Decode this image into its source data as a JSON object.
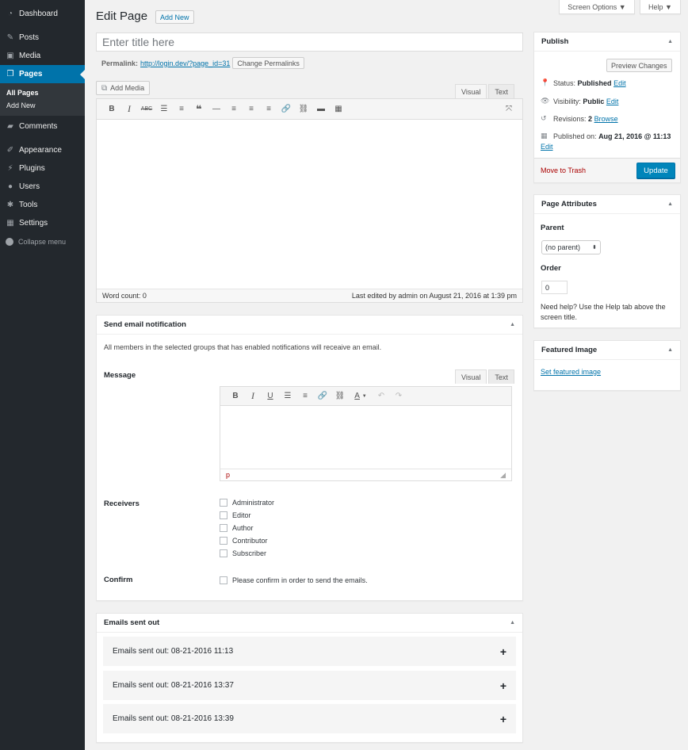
{
  "sidebar": {
    "items": [
      {
        "label": "Dashboard",
        "icon": "dashboard-icon"
      },
      {
        "label": "Posts",
        "icon": "pin-icon"
      },
      {
        "label": "Media",
        "icon": "media-icon"
      },
      {
        "label": "Pages",
        "icon": "pages-icon"
      },
      {
        "label": "Comments",
        "icon": "comments-icon"
      },
      {
        "label": "Appearance",
        "icon": "brush-icon"
      },
      {
        "label": "Plugins",
        "icon": "plugin-icon"
      },
      {
        "label": "Users",
        "icon": "users-icon"
      },
      {
        "label": "Tools",
        "icon": "wrench-icon"
      },
      {
        "label": "Settings",
        "icon": "settings-icon"
      }
    ],
    "submenu": [
      "All Pages",
      "Add New"
    ],
    "collapse": "Collapse menu"
  },
  "top": {
    "screen_options": "Screen Options ▼",
    "help": "Help ▼"
  },
  "header": {
    "title": "Edit Page",
    "add_new": "Add New"
  },
  "post": {
    "title_placeholder": "Enter title here",
    "permalink_label": "Permalink:",
    "permalink_url": "http://login.dev/?page_id=31",
    "change_permalinks": "Change Permalinks",
    "add_media": "Add Media",
    "tab_visual": "Visual",
    "tab_text": "Text",
    "word_count": "Word count: 0",
    "last_edited": "Last edited by admin on August 21, 2016 at 1:39 pm"
  },
  "notify": {
    "title": "Send email notification",
    "intro": "All members in the selected groups that has enabled notifications will receaive an email.",
    "message_label": "Message",
    "tab_visual": "Visual",
    "tab_text": "Text",
    "path": "p",
    "receivers_label": "Receivers",
    "receivers": [
      "Administrator",
      "Editor",
      "Author",
      "Contributor",
      "Subscriber"
    ],
    "confirm_label": "Confirm",
    "confirm_text": "Please confirm in order to send the emails."
  },
  "sent": {
    "title": "Emails sent out",
    "rows": [
      "Emails sent out: 08-21-2016 11:13",
      "Emails sent out: 08-21-2016 13:37",
      "Emails sent out: 08-21-2016 13:39"
    ]
  },
  "publish": {
    "title": "Publish",
    "preview": "Preview Changes",
    "status_label": "Status:",
    "status_value": "Published",
    "visibility_label": "Visibility:",
    "visibility_value": "Public",
    "revisions_label": "Revisions:",
    "revisions_value": "2",
    "browse": "Browse",
    "published_label": "Published on:",
    "published_value": "Aug 21, 2016 @ 11:13",
    "edit": "Edit",
    "trash": "Move to Trash",
    "update": "Update"
  },
  "attributes": {
    "title": "Page Attributes",
    "parent_label": "Parent",
    "parent_value": "(no parent)",
    "order_label": "Order",
    "order_value": "0",
    "help_text": "Need help? Use the Help tab above the screen title."
  },
  "featured": {
    "title": "Featured Image",
    "link": "Set featured image"
  }
}
